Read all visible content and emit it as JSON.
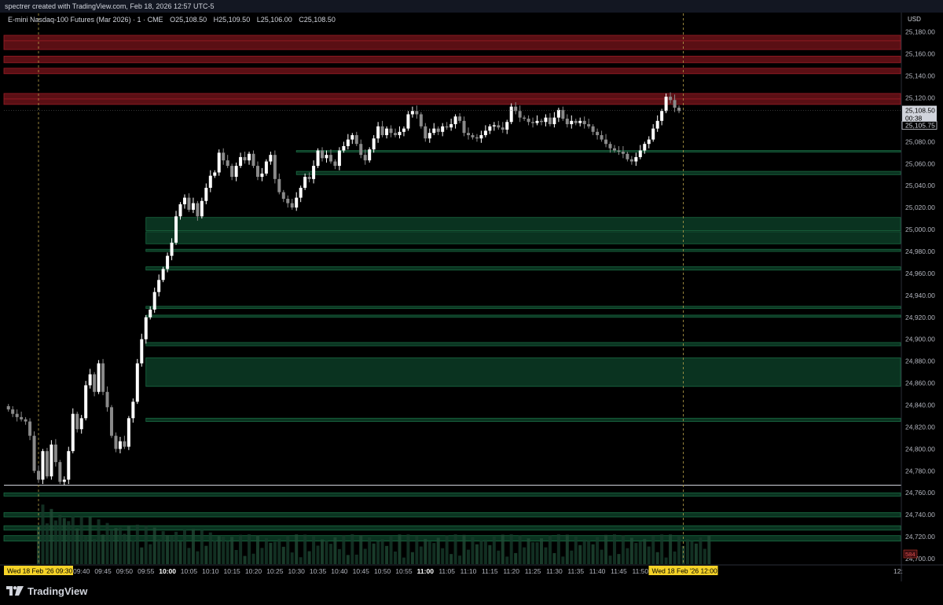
{
  "header": {
    "credit": "spectrer created with TradingView.com, Feb 18, 2026 12:57 UTC-5"
  },
  "legend": {
    "symbol": "E-mini Nasdaq-100 Futures (Mar 2026) · 1 · CME",
    "open": "O25,108.50",
    "high": "H25,109.50",
    "low": "L25,106.00",
    "close": "C25,108.50"
  },
  "price_axis": {
    "currency": "USD",
    "last_price_label": "25,108.50",
    "countdown_label": "00:38",
    "secondary_price_label": "25,105.75",
    "volume_badge": "584"
  },
  "time_axis": {
    "start_marker": "Wed 18 Feb '26",
    "start_marker_time": "09:30",
    "end_marker": "Wed 18 Feb '26",
    "end_marker_time": "12:00",
    "cut_label": "12:"
  },
  "footer": {
    "brand": "TradingView"
  },
  "colors": {
    "up_candle": "#ffffff",
    "down_candle": "#8a8a8a",
    "supply_zone": "#5a0f14",
    "demand_zone": "#0a3320",
    "session_line": "#b8a24a",
    "marker_bg": "#f5d328"
  },
  "chart_data": {
    "type": "candlestick",
    "ylim": [
      24695,
      25197
    ],
    "yticks": [
      25180,
      25160,
      25140,
      25120,
      25100,
      25080,
      25060,
      25040,
      25020,
      25000,
      24980,
      24960,
      24940,
      24920,
      24900,
      24880,
      24860,
      24840,
      24820,
      24800,
      24780,
      24760,
      24740,
      24720,
      24700
    ],
    "ytick_labels": [
      "25,180.00",
      "25,160.00",
      "25,140.00",
      "25,120.00",
      "25,100.00",
      "25,080.00",
      "25,060.00",
      "25,040.00",
      "25,020.00",
      "25,000.00",
      "24,980.00",
      "24,960.00",
      "24,940.00",
      "24,920.00",
      "24,900.00",
      "24,880.00",
      "24,860.00",
      "24,840.00",
      "24,820.00",
      "24,800.00",
      "24,780.00",
      "24,760.00",
      "24,740.00",
      "24,720.00",
      "24,700.00"
    ],
    "xtick_labels": [
      "09:40",
      "09:45",
      "09:50",
      "09:55",
      "10:00",
      "10:05",
      "10:10",
      "10:15",
      "10:20",
      "10:25",
      "10:30",
      "10:35",
      "10:40",
      "10:45",
      "10:50",
      "10:55",
      "11:00",
      "11:05",
      "11:10",
      "11:15",
      "11:20",
      "11:25",
      "11:30",
      "11:35",
      "11:40",
      "11:45",
      "11:50"
    ],
    "xtick_minutes": [
      10,
      15,
      20,
      25,
      30,
      35,
      40,
      45,
      50,
      55,
      60,
      65,
      70,
      75,
      80,
      85,
      90,
      95,
      100,
      105,
      110,
      115,
      120,
      125,
      130,
      135,
      140
    ],
    "xtick_bold": [
      "10:00",
      "11:00"
    ],
    "session_start_minute": 0,
    "session_end_minute": 150,
    "minutes_total": 162,
    "candles_close": [
      24836,
      24832,
      24829,
      24827,
      24825,
      24812,
      24780,
      24772,
      24798,
      24775,
      24804,
      24788,
      24770,
      24772,
      24798,
      24832,
      24818,
      24828,
      24858,
      24868,
      24852,
      24878,
      24852,
      24838,
      24812,
      24800,
      24807,
      24802,
      24828,
      24843,
      24878,
      24900,
      24920,
      24927,
      24943,
      24954,
      24964,
      24976,
      24988,
      25012,
      25023,
      25029,
      25018,
      25024,
      25012,
      25026,
      25038,
      25049,
      25052,
      25070,
      25063,
      25058,
      25048,
      25058,
      25066,
      25063,
      25069,
      25058,
      25048,
      25051,
      25062,
      25068,
      25046,
      25034,
      25028,
      25024,
      25020,
      25029,
      25038,
      25048,
      25046,
      25058,
      25072,
      25065,
      25068,
      25062,
      25058,
      25072,
      25076,
      25082,
      25086,
      25078,
      25068,
      25063,
      25073,
      25083,
      25094,
      25086,
      25092,
      25088,
      25086,
      25089,
      25092,
      25105,
      25108,
      25105,
      25094,
      25083,
      25088,
      25092,
      25089,
      25094,
      25093,
      25096,
      25103,
      25099,
      25088,
      25086,
      25084,
      25083,
      25086,
      25090,
      25094,
      25095,
      25093,
      25091,
      25098,
      25112,
      25108,
      25102,
      25101,
      25098,
      25097,
      25099,
      25098,
      25102,
      25096,
      25102,
      25109,
      25101,
      25096,
      25099,
      25097,
      25099,
      25096,
      25094,
      25089,
      25086,
      25082,
      25078,
      25074,
      25072,
      25071,
      25069,
      25064,
      25062,
      25066,
      25072,
      25078,
      25082,
      25092,
      25099,
      25108,
      25121,
      25118,
      25111,
      25108
    ],
    "volume_max_label": "584",
    "supply_zones": [
      [
        25172,
        25177
      ],
      [
        25164,
        25172
      ],
      [
        25152,
        25158
      ],
      [
        25142,
        25147
      ],
      [
        25119,
        25124
      ],
      [
        25114,
        25119
      ]
    ],
    "demand_zones": [
      [
        25072,
        25071
      ],
      [
        25053,
        25050
      ],
      [
        25011,
        24999
      ],
      [
        24998,
        24987
      ],
      [
        24982,
        24980
      ],
      [
        24966,
        24963
      ],
      [
        24930,
        24928
      ],
      [
        24922,
        24920
      ],
      [
        24897,
        24894
      ],
      [
        24883,
        24857
      ],
      [
        24828,
        24825
      ],
      [
        24760,
        24757
      ],
      [
        24742,
        24738
      ],
      [
        24730,
        24726
      ],
      [
        24721,
        24716
      ]
    ],
    "horizontal_level": 24767,
    "current_price": 25108.5
  }
}
